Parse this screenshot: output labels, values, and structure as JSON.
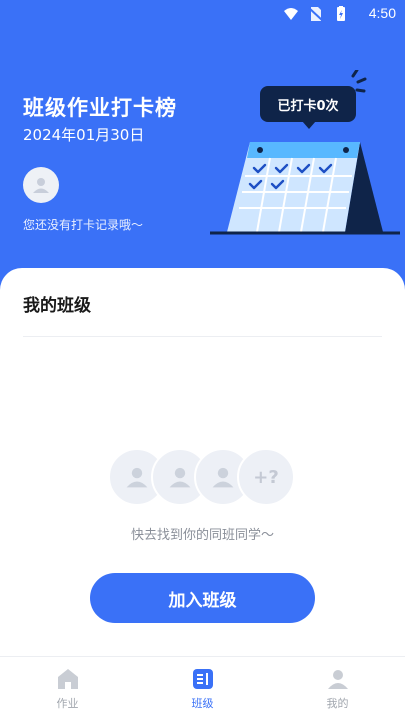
{
  "status_bar": {
    "time": "4:50"
  },
  "hero": {
    "title": "班级作业打卡榜",
    "date": "2024年01月30日",
    "no_record_text": "您还没有打卡记录哦～",
    "badge_text": "已打卡0次"
  },
  "my_class": {
    "title": "我的班级",
    "more_placeholder": "+?",
    "empty_hint": "快去找到你的同班同学～",
    "join_button": "加入班级"
  },
  "tabs": [
    {
      "label": "作业",
      "icon": "home-icon",
      "active": false
    },
    {
      "label": "班级",
      "icon": "class-icon",
      "active": true
    },
    {
      "label": "我的",
      "icon": "user-icon",
      "active": false
    }
  ],
  "colors": {
    "primary": "#3a71f7",
    "badge": "#0f2449",
    "tab_inactive": "#a1a6ae"
  }
}
